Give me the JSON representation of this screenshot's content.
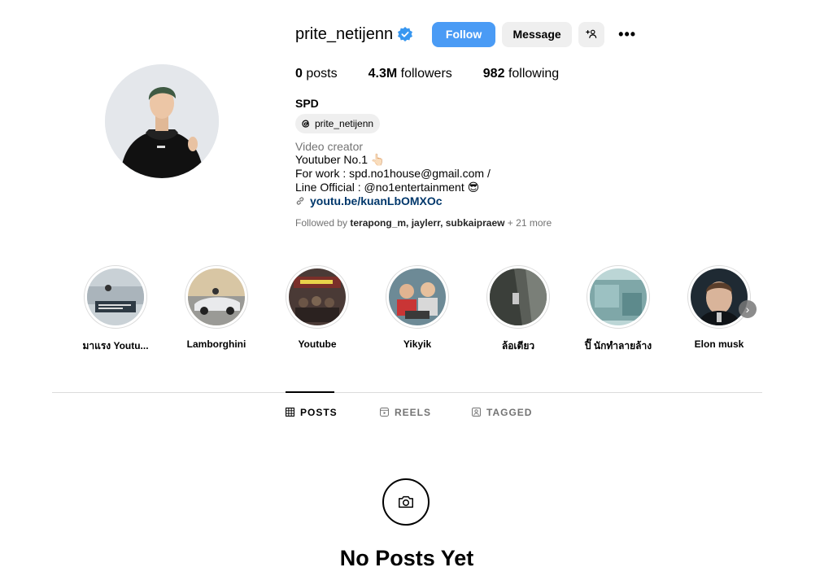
{
  "profile": {
    "username": "prite_netijenn",
    "follow_label": "Follow",
    "message_label": "Message",
    "add_user_label": "+2",
    "more_label": "•••",
    "stats": {
      "posts_count": "0",
      "posts_label": "posts",
      "followers_count": "4.3M",
      "followers_label": "followers",
      "following_count": "982",
      "following_label": "following"
    },
    "bio": {
      "name": "SPD",
      "threads_handle": "prite_netijenn",
      "category": "Video creator",
      "line1": "Youtuber No.1 👆🏻",
      "line2": "For work : spd.no1house@gmail.com /",
      "line3": "Line Official : @no1entertainment 😎",
      "link": "youtu.be/kuanLbOMXOc"
    },
    "followed_by": {
      "prefix": "Followed by",
      "names": "terapong_m, jaylerr, subkaipraew",
      "suffix": "+ 21 more"
    }
  },
  "highlights": [
    {
      "label": "มาแรง Youtu..."
    },
    {
      "label": "Lamborghini"
    },
    {
      "label": "Youtube"
    },
    {
      "label": "Yikyik"
    },
    {
      "label": "ล้อเตียว"
    },
    {
      "label": "ปิ๊ นักทำลายล้าง"
    },
    {
      "label": "Elon musk"
    }
  ],
  "tabs": {
    "posts": "POSTS",
    "reels": "REELS",
    "tagged": "TAGGED"
  },
  "empty_state": {
    "title": "No Posts Yet"
  },
  "colors": {
    "follow_button": "#4a9bf5",
    "verified_badge": "#3897f0",
    "link": "#00376b"
  }
}
